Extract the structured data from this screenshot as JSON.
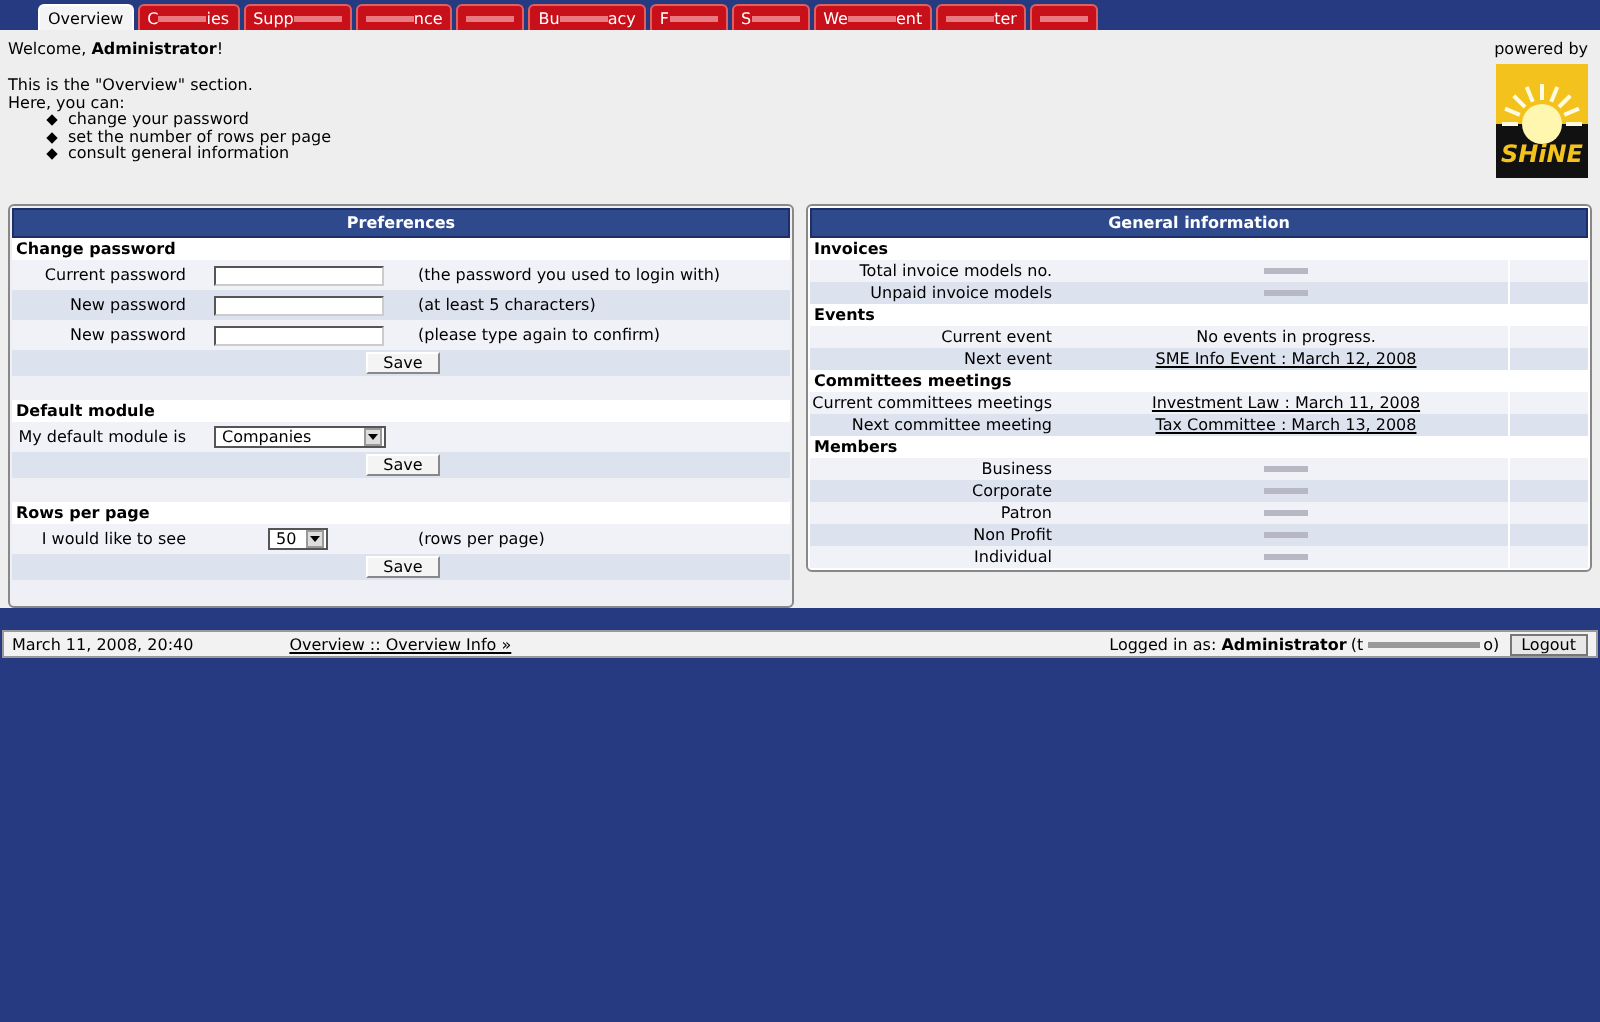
{
  "tabs": [
    {
      "kind": "plain",
      "label": "Overview",
      "selected": true
    },
    {
      "kind": "redacted",
      "prefix": "C",
      "suffix": "ies",
      "selected": false
    },
    {
      "kind": "redacted",
      "prefix": "Supp",
      "selected": false
    },
    {
      "kind": "redacted",
      "suffix": "nce",
      "selected": false
    },
    {
      "kind": "redacted",
      "selected": false
    },
    {
      "kind": "redacted",
      "prefix": "Bu",
      "suffix": "acy",
      "selected": false
    },
    {
      "kind": "redacted",
      "prefix": "F",
      "selected": false
    },
    {
      "kind": "redacted",
      "prefix": "S",
      "selected": false
    },
    {
      "kind": "redacted",
      "prefix": "We",
      "suffix": "ent",
      "selected": false
    },
    {
      "kind": "redacted",
      "suffix": "ter",
      "selected": false
    },
    {
      "kind": "redacted",
      "selected": false
    }
  ],
  "intro": {
    "welcome": "Welcome, **Administrator**!",
    "section": "This is the \"Overview\" section.",
    "lead": "Here, you can:",
    "bullets": [
      "change your password",
      "set the number of rows per page",
      "consult general information"
    ]
  },
  "logo": {
    "caption": "powered by",
    "name": "SHiNE"
  },
  "preferences": {
    "title": "Preferences",
    "groups": [
      {
        "heading": "Change password",
        "button": "Save",
        "rows": [
          {
            "kind": "password",
            "label": "Current password",
            "hint": "(the password you used to login with)"
          },
          {
            "kind": "password",
            "label": "New password",
            "hint": "(at least 5 characters)"
          },
          {
            "kind": "password",
            "label": "New password",
            "hint": "(please type again to confirm)"
          }
        ]
      },
      {
        "heading": "Default module",
        "button": "Save",
        "rows": [
          {
            "kind": "select",
            "label": "My default module is",
            "value": "Companies"
          }
        ]
      },
      {
        "heading": "Rows per page",
        "button": "Save",
        "rows": [
          {
            "kind": "select-small",
            "label": "I would like to see",
            "value": "50",
            "hint": "(rows per page)"
          }
        ]
      }
    ]
  },
  "general": {
    "title": "General information",
    "groups": [
      {
        "heading": "Invoices",
        "rows": [
          {
            "kind": "redacted",
            "label": "Total invoice models no."
          },
          {
            "kind": "redacted",
            "label": "Unpaid invoice models"
          }
        ]
      },
      {
        "heading": "Events",
        "rows": [
          {
            "kind": "text",
            "label": "Current event",
            "value": "No events in progress."
          },
          {
            "kind": "link",
            "label": "Next event",
            "value": "SME Info Event : March 12, 2008"
          }
        ]
      },
      {
        "heading": "Committees meetings",
        "rows": [
          {
            "kind": "link",
            "label": "Current committees meetings",
            "value": "Investment Law : March 11, 2008"
          },
          {
            "kind": "link",
            "label": "Next committee meeting",
            "value": "Tax Committee : March 13, 2008"
          }
        ]
      },
      {
        "heading": "Members",
        "rows": [
          {
            "kind": "redacted",
            "label": "Business"
          },
          {
            "kind": "redacted",
            "label": "Corporate"
          },
          {
            "kind": "redacted",
            "label": "Patron"
          },
          {
            "kind": "redacted",
            "label": "Non Profit"
          },
          {
            "kind": "redacted",
            "label": "Individual"
          }
        ]
      }
    ]
  },
  "footer": {
    "datetime": "March 11, 2008, 20:40",
    "breadcrumb": "Overview :: Overview Info »",
    "login_text": "Logged in as: **Administrator**",
    "user_prefix": "(t",
    "user_suffix": "o)",
    "logout": "Logout"
  }
}
